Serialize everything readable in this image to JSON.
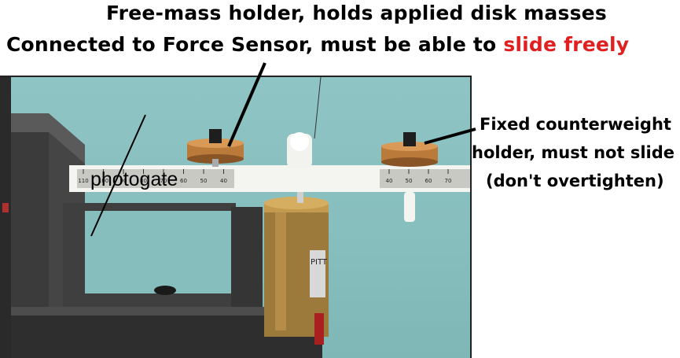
{
  "captions": {
    "line1": "Free-mass holder, holds applied disk masses",
    "line2_prefix": "Connected to Force Sensor, must be able to ",
    "line2_emphasis": "slide freely",
    "emphasis_color": "#e02020"
  },
  "counterweight_note": {
    "line1": "Fixed counterweight",
    "line2": "holder, must not slide",
    "line3": "(don't overtighten)"
  },
  "photo_labels": {
    "photogate": "photogate",
    "sensor_brand": "PITT"
  },
  "scale_left_ticks": [
    "110",
    "100",
    "90",
    "80",
    "70",
    "60",
    "50",
    "40"
  ],
  "scale_right_ticks": [
    "40",
    "50",
    "60",
    "70"
  ]
}
